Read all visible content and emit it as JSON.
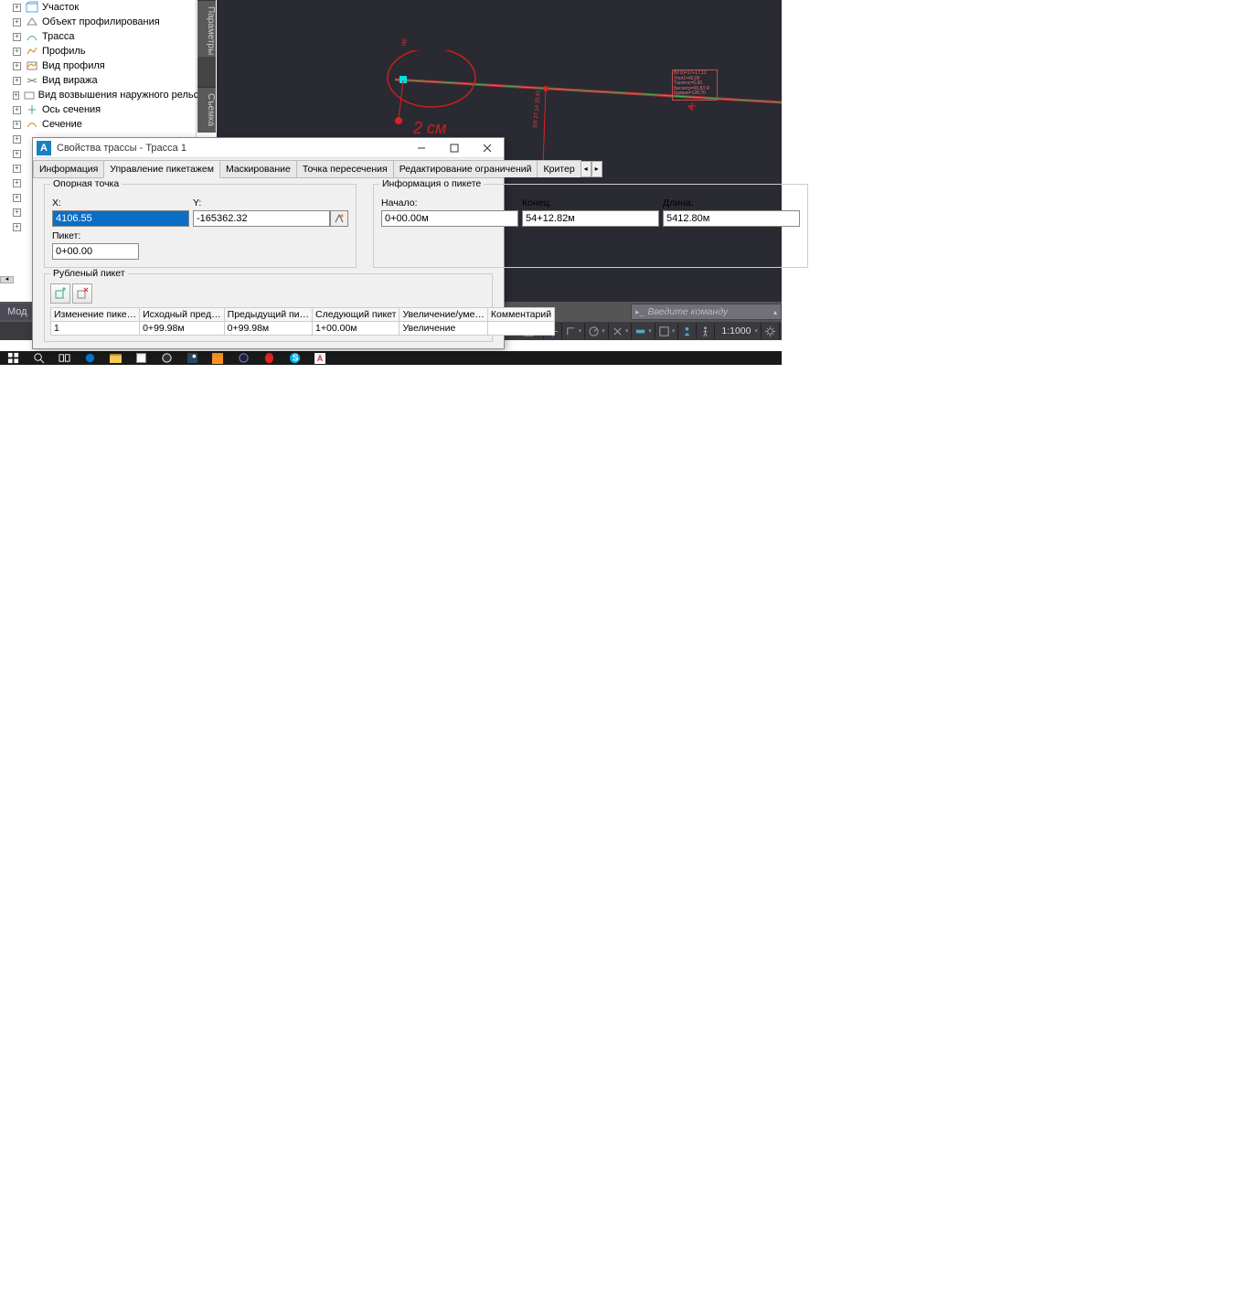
{
  "tree": {
    "items": [
      {
        "label": "Участок"
      },
      {
        "label": "Объект профилирования"
      },
      {
        "label": "Трасса"
      },
      {
        "label": "Профиль"
      },
      {
        "label": "Вид профиля"
      },
      {
        "label": "Вид виража"
      },
      {
        "label": "Вид возвышения наружного рельса"
      },
      {
        "label": "Ось сечения"
      },
      {
        "label": "Сечение"
      }
    ]
  },
  "side_tabs": {
    "params": "Параметры",
    "survey": "Съемка"
  },
  "viewport": {
    "info_box": "ВУ10=17+17,12\nУгол1=40,00\nTангенс=0,00\nБисектр=66,83 R\nКривая=128,70"
  },
  "dialog": {
    "title": "Свойства трассы - Трасса 1",
    "tabs": [
      "Информация",
      "Управление пикетажем",
      "Маскирование",
      "Точка пересечения",
      "Редактирование ограничений",
      "Критер"
    ],
    "active_tab": 1,
    "ref_point": {
      "legend": "Опорная точка",
      "x_label": "X:",
      "y_label": "Y:",
      "x_value": "4106.55",
      "y_value": "-165362.32",
      "pk_label": "Пикет:",
      "pk_value": "0+00.00"
    },
    "pk_info": {
      "legend": "Информация о пикете",
      "start_label": "Начало:",
      "end_label": "Конец:",
      "len_label": "Длина:",
      "start_value": "0+00.00м",
      "end_value": "54+12.82м",
      "len_value": "5412.80м"
    },
    "chopped": {
      "legend": "Рубленый пикет",
      "headers": [
        "Изменение пике…",
        "Исходный пред…",
        "Предыдущий пи…",
        "Следующий пикет",
        "Увеличение/уме…",
        "Комментарий"
      ],
      "row": [
        "1",
        "0+99.98м",
        "0+99.98м",
        "1+00.00м",
        "Увеличение",
        ""
      ]
    },
    "annotation": "2 см"
  },
  "cmd": {
    "model_tab": "Мод",
    "placeholder": "Введите команду"
  },
  "status": {
    "scale": "1:1000"
  }
}
